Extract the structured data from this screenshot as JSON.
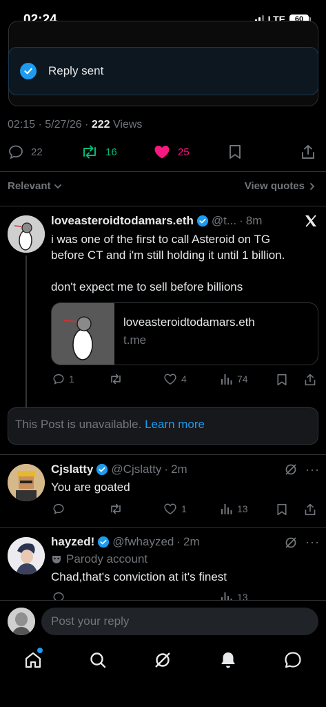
{
  "status_bar": {
    "time": "02:24",
    "network": "LTE",
    "battery": "60"
  },
  "toast": {
    "text": "Reply sent"
  },
  "post_meta": {
    "time": "02:15",
    "date": "5/27/26",
    "views_count": "222",
    "views_label": "Views"
  },
  "actions": {
    "replies": "22",
    "reposts": "16",
    "likes": "25"
  },
  "sort": {
    "label": "Relevant",
    "view_quotes": "View quotes"
  },
  "replies": [
    {
      "name": "loveasteroidtodamars.eth",
      "handle": "@t...",
      "time": "8m",
      "lines": [
        "i was one of the first to call Asteroid on TG",
        "before CT and i'm still holding it until 1 billion."
      ],
      "line3": "don't expect me to sell before billions",
      "card": {
        "title": "loveasteroidtodamars.eth",
        "domain": "t.me"
      },
      "stats": {
        "replies": "1",
        "likes": "4",
        "views": "74"
      }
    },
    {
      "name": "Cjslatty",
      "handle": "@Cjslatty",
      "time": "2m",
      "text": "You are goated",
      "stats": {
        "likes": "1",
        "views": "13"
      }
    },
    {
      "name": "hayzed!",
      "handle": "@fwhayzed",
      "time": "2m",
      "label": "Parody account",
      "text": "Chad,that's conviction at it's finest",
      "stats": {
        "views": "13"
      }
    }
  ],
  "unavailable": {
    "text": "This Post is unavailable.",
    "link": "Learn more"
  },
  "composer": {
    "placeholder": "Post your reply"
  },
  "colors": {
    "accent": "#1d9bf0",
    "repost": "#00ba7c",
    "like": "#f91880",
    "muted": "#71767b"
  }
}
